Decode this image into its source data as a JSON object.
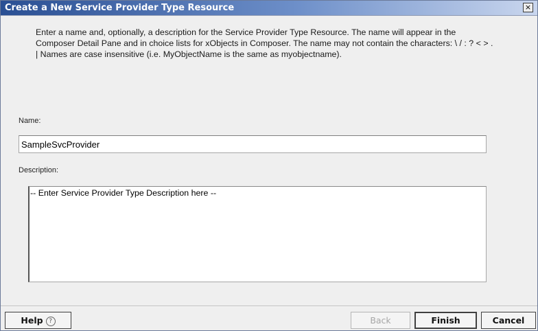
{
  "window": {
    "title": "Create a New Service Provider Type Resource",
    "close_label": "×",
    "close_icon": "close-icon"
  },
  "instructions": {
    "text": "Enter a name and, optionally, a description for the Service Provider Type Resource. The name will appear in the Composer Detail Pane and in choice lists for xObjects in Composer. The name may not contain the characters: \\ / : ? < > . |   Names are case insensitive (i.e. MyObjectName is the same as myobjectname)."
  },
  "form": {
    "name_label": "Name:",
    "name_value": "SampleSvcProvider",
    "description_label": "Description:",
    "description_value": "-- Enter Service Provider Type Description here --"
  },
  "buttons": {
    "help_label": "Help",
    "help_icon": "help-circle-icon",
    "help_icon_glyph": "?",
    "back_label": "Back",
    "finish_label": "Finish",
    "cancel_label": "Cancel"
  },
  "colors": {
    "titlebar_start": "#2a4f93",
    "titlebar_end": "#c9d6ee",
    "dialog_background": "#efefef"
  }
}
